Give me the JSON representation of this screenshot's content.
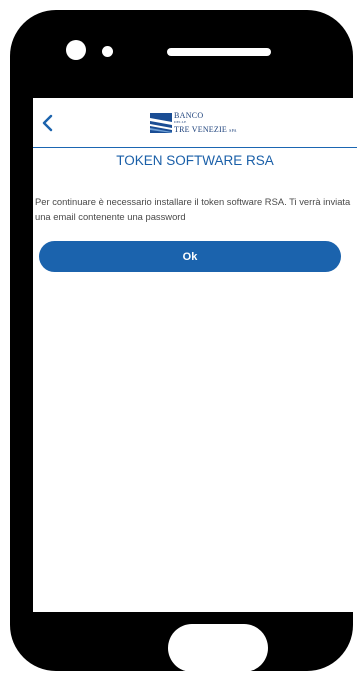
{
  "header": {
    "back_icon": "chevron-left-icon",
    "logo": {
      "line1": "BANCO",
      "line2": "DELLE",
      "line3": "TRE VENEZIE",
      "suffix": "SPA"
    }
  },
  "main": {
    "title": "TOKEN SOFTWARE RSA",
    "message": "Per continuare è necessario installare il token software RSA. Ti verrà inviata una email contenente una password",
    "ok_label": "Ok"
  },
  "colors": {
    "accent": "#1b63ad",
    "title": "#1a5fa8",
    "logo": "#1a3f7a",
    "phone_frame": "#000000"
  }
}
